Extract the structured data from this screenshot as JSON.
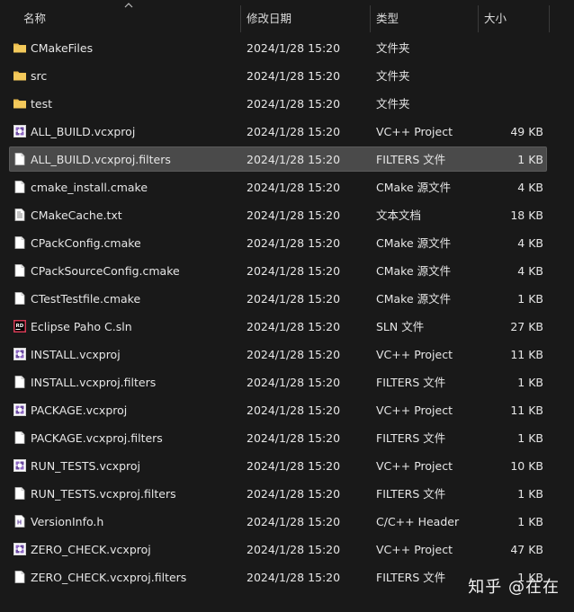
{
  "header": {
    "name": "名称",
    "date": "修改日期",
    "type": "类型",
    "size": "大小"
  },
  "rows": [
    {
      "name": "CMakeFiles",
      "date": "2024/1/28 15:20",
      "type": "文件夹",
      "size": "",
      "icon": "folder-icon",
      "selected": false
    },
    {
      "name": "src",
      "date": "2024/1/28 15:20",
      "type": "文件夹",
      "size": "",
      "icon": "folder-icon",
      "selected": false
    },
    {
      "name": "test",
      "date": "2024/1/28 15:20",
      "type": "文件夹",
      "size": "",
      "icon": "folder-icon",
      "selected": false
    },
    {
      "name": "ALL_BUILD.vcxproj",
      "date": "2024/1/28 15:20",
      "type": "VC++ Project",
      "size": "49 KB",
      "icon": "vcxproj-icon",
      "selected": false
    },
    {
      "name": "ALL_BUILD.vcxproj.filters",
      "date": "2024/1/28 15:20",
      "type": "FILTERS 文件",
      "size": "1 KB",
      "icon": "file-icon",
      "selected": true
    },
    {
      "name": "cmake_install.cmake",
      "date": "2024/1/28 15:20",
      "type": "CMake 源文件",
      "size": "4 KB",
      "icon": "file-icon",
      "selected": false
    },
    {
      "name": "CMakeCache.txt",
      "date": "2024/1/28 15:20",
      "type": "文本文档",
      "size": "18 KB",
      "icon": "text-file-icon",
      "selected": false
    },
    {
      "name": "CPackConfig.cmake",
      "date": "2024/1/28 15:20",
      "type": "CMake 源文件",
      "size": "4 KB",
      "icon": "file-icon",
      "selected": false
    },
    {
      "name": "CPackSourceConfig.cmake",
      "date": "2024/1/28 15:20",
      "type": "CMake 源文件",
      "size": "4 KB",
      "icon": "file-icon",
      "selected": false
    },
    {
      "name": "CTestTestfile.cmake",
      "date": "2024/1/28 15:20",
      "type": "CMake 源文件",
      "size": "1 KB",
      "icon": "file-icon",
      "selected": false
    },
    {
      "name": "Eclipse Paho C.sln",
      "date": "2024/1/28 15:20",
      "type": "SLN 文件",
      "size": "27 KB",
      "icon": "rider-sln-icon",
      "selected": false
    },
    {
      "name": "INSTALL.vcxproj",
      "date": "2024/1/28 15:20",
      "type": "VC++ Project",
      "size": "11 KB",
      "icon": "vcxproj-icon",
      "selected": false
    },
    {
      "name": "INSTALL.vcxproj.filters",
      "date": "2024/1/28 15:20",
      "type": "FILTERS 文件",
      "size": "1 KB",
      "icon": "file-icon",
      "selected": false
    },
    {
      "name": "PACKAGE.vcxproj",
      "date": "2024/1/28 15:20",
      "type": "VC++ Project",
      "size": "11 KB",
      "icon": "vcxproj-icon",
      "selected": false
    },
    {
      "name": "PACKAGE.vcxproj.filters",
      "date": "2024/1/28 15:20",
      "type": "FILTERS 文件",
      "size": "1 KB",
      "icon": "file-icon",
      "selected": false
    },
    {
      "name": "RUN_TESTS.vcxproj",
      "date": "2024/1/28 15:20",
      "type": "VC++ Project",
      "size": "10 KB",
      "icon": "vcxproj-icon",
      "selected": false
    },
    {
      "name": "RUN_TESTS.vcxproj.filters",
      "date": "2024/1/28 15:20",
      "type": "FILTERS 文件",
      "size": "1 KB",
      "icon": "file-icon",
      "selected": false
    },
    {
      "name": "VersionInfo.h",
      "date": "2024/1/28 15:20",
      "type": "C/C++ Header",
      "size": "1 KB",
      "icon": "header-file-icon",
      "selected": false
    },
    {
      "name": "ZERO_CHECK.vcxproj",
      "date": "2024/1/28 15:20",
      "type": "VC++ Project",
      "size": "47 KB",
      "icon": "vcxproj-icon",
      "selected": false
    },
    {
      "name": "ZERO_CHECK.vcxproj.filters",
      "date": "2024/1/28 15:20",
      "type": "FILTERS 文件",
      "size": "1 KB",
      "icon": "file-icon",
      "selected": false
    }
  ],
  "watermark": "知乎 @在在",
  "colors": {
    "background": "#191919",
    "selection": "#4a4a4a",
    "folder": "#e8b94a",
    "vcxproj": "#8f6ac4",
    "rider": "#d43b55"
  }
}
